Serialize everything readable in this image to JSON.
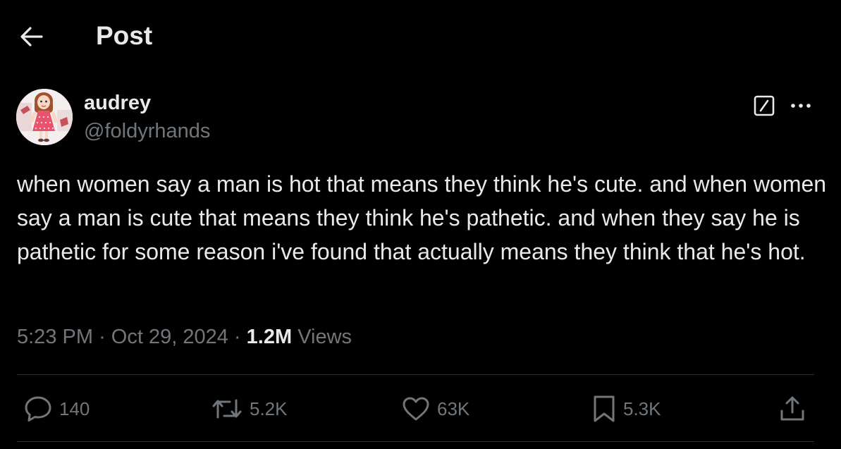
{
  "header": {
    "title": "Post",
    "back_icon": "arrow-left-icon"
  },
  "author": {
    "name": "audrey",
    "handle": "@foldyrhands",
    "avatar_icon": "doll-avatar"
  },
  "tweet": {
    "text": "when women say a man is hot that means they think he's cute. and when women say a man is cute that means they think he's pathetic. and when they say he is pathetic for some reason i've found that actually means they think that he's hot."
  },
  "meta": {
    "time": "5:23 PM",
    "separator": "·",
    "date": "Oct 29, 2024",
    "views_count": "1.2M",
    "views_label": "Views"
  },
  "actions": {
    "replies": "140",
    "reposts": "5.2K",
    "likes": "63K",
    "bookmarks": "5.3K"
  },
  "colors": {
    "background": "#000000",
    "primary_text": "#e7e9ea",
    "secondary_text": "#71767b",
    "divider": "#2f3336"
  }
}
